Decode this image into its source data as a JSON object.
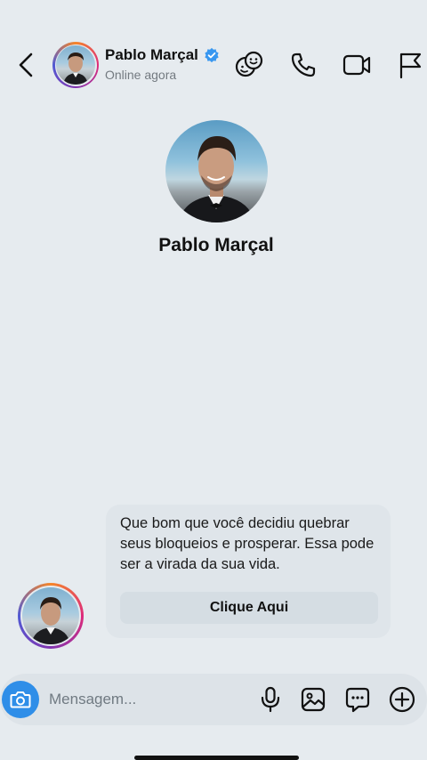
{
  "header": {
    "name": "Pablo Marçal",
    "status": "Online agora",
    "icons": [
      "back-chevron-icon",
      "sticker-faces-icon",
      "phone-icon",
      "video-camera-icon",
      "flag-icon"
    ]
  },
  "profile": {
    "name": "Pablo Marçal"
  },
  "message": {
    "text": "Que bom que você decidiu quebrar seus bloqueios e prosperar. Essa pode ser a virada da sua vida.",
    "button_label": "Clique Aqui"
  },
  "composer": {
    "placeholder": "Mensagem...",
    "icons": [
      "camera-icon",
      "microphone-icon",
      "gallery-icon",
      "chat-bubble-icon",
      "plus-circle-icon"
    ]
  },
  "colors": {
    "background": "#e6ebef",
    "accent": "#2f8ee8",
    "verified": "#3897f0"
  }
}
